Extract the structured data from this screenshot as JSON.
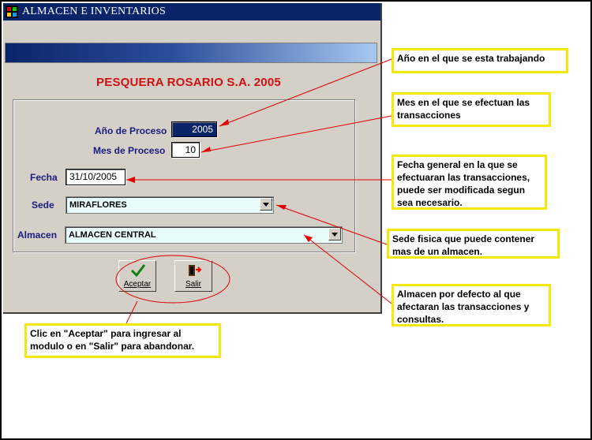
{
  "window": {
    "title": "ALMACEN E INVENTARIOS",
    "company": "PESQUERA ROSARIO S.A.  2005"
  },
  "form": {
    "anio_label": "Año de Proceso",
    "anio_value": "2005",
    "mes_label": "Mes de Proceso",
    "mes_value": "10",
    "fecha_label": "Fecha",
    "fecha_value": "31/10/2005",
    "sede_label": "Sede",
    "sede_value": "MIRAFLORES",
    "almacen_label": "Almacen",
    "almacen_value": "ALMACEN CENTRAL"
  },
  "buttons": {
    "aceptar": "Aceptar",
    "salir": "Salir"
  },
  "notes": {
    "anio": "Año en el que se esta trabajando",
    "mes_l1": "Mes en el que se efectuan las",
    "mes_l2": "transacciones",
    "fecha_l1": "Fecha general en la que se",
    "fecha_l2": "efectuaran las transacciones,",
    "fecha_l3": "puede ser modificada segun",
    "fecha_l4": "sea necesario.",
    "sede_l1": "Sede fisica que puede contener",
    "sede_l2": "mas de un almacen.",
    "almacen_l1": "Almacen por defecto al que",
    "almacen_l2": "afectaran las transacciones  y",
    "almacen_l3": "consultas.",
    "clic_l1": "Clic en \"Aceptar\" para ingresar al",
    "clic_l2": "modulo o en \"Salir\" para abandonar."
  },
  "colors": {
    "title_bar": "#0a246a",
    "company_text": "#d01010",
    "label_text": "#1a1a80",
    "annotation_border": "#f5e80a",
    "arrow": "#e00000"
  }
}
